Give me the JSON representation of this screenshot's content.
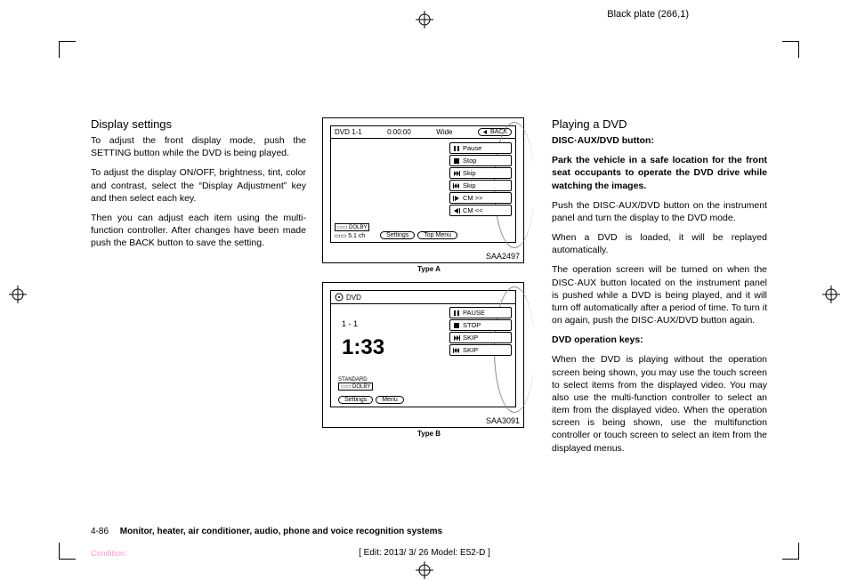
{
  "meta": {
    "plate_header": "Black plate (266,1)",
    "page_num": "4-86",
    "section_title": "Monitor, heater, air conditioner, audio, phone and voice recognition systems",
    "edit_line": "[ Edit: 2013/ 3/ 26   Model: E52-D ]",
    "condition": "Condition:"
  },
  "left": {
    "heading": "Display settings",
    "p1": "To adjust the front display mode, push the SETTING button while the DVD is being played.",
    "p2": "To adjust the display ON/OFF, brightness, tint, color and contrast, select the “Display Adjustment” key and then select each key.",
    "p3": "Then you can adjust each item using the multi-function controller. After changes have been made push the BACK button to save the setting."
  },
  "figA": {
    "code": "SAA2497",
    "type": "Type A",
    "hdr_left": "DVD  1-1",
    "hdr_time": "0:00:00",
    "hdr_mode": "Wide",
    "back": "BACK",
    "menu": [
      "Pause",
      "Stop",
      "Skip",
      "Skip",
      "CM >>",
      "CM <<"
    ],
    "dolby": "DOLBY",
    "ch": "5.1 ch",
    "btn1": "Settings",
    "btn2": "Top Menu"
  },
  "figB": {
    "code": "SAA3091",
    "type": "Type B",
    "hdr": "DVD",
    "track": "1 - 1",
    "time": "1:33",
    "menu": [
      "PAUSE",
      "STOP",
      "SKIP",
      "SKIP"
    ],
    "std": "STANDARD",
    "dolby": "DOLBY",
    "btn1": "Settings",
    "btn2": "Menu"
  },
  "right": {
    "heading": "Playing a DVD",
    "sub1": "DISC·AUX/DVD button:",
    "warn": "Park the vehicle in a safe location for the front seat occupants to operate the DVD drive while watching the images.",
    "p1": "Push the DISC·AUX/DVD button on the instrument panel and turn the display to the DVD mode.",
    "p2": "When a DVD is loaded, it will be replayed automatically.",
    "p3": "The operation screen will be turned on when the DISC·AUX button located on the instrument panel is pushed while a DVD is being played, and it will turn off automatically after a period of time. To turn it on again, push the DISC·AUX/DVD button again.",
    "sub2": "DVD operation keys:",
    "p4": "When the DVD is playing without the operation screen being shown, you may use the touch screen to select items from the displayed video. You may also use the multi-function controller to select an item from the displayed video. When the operation screen is being shown, use the multifunction controller or touch screen to select an item from the displayed menus."
  }
}
